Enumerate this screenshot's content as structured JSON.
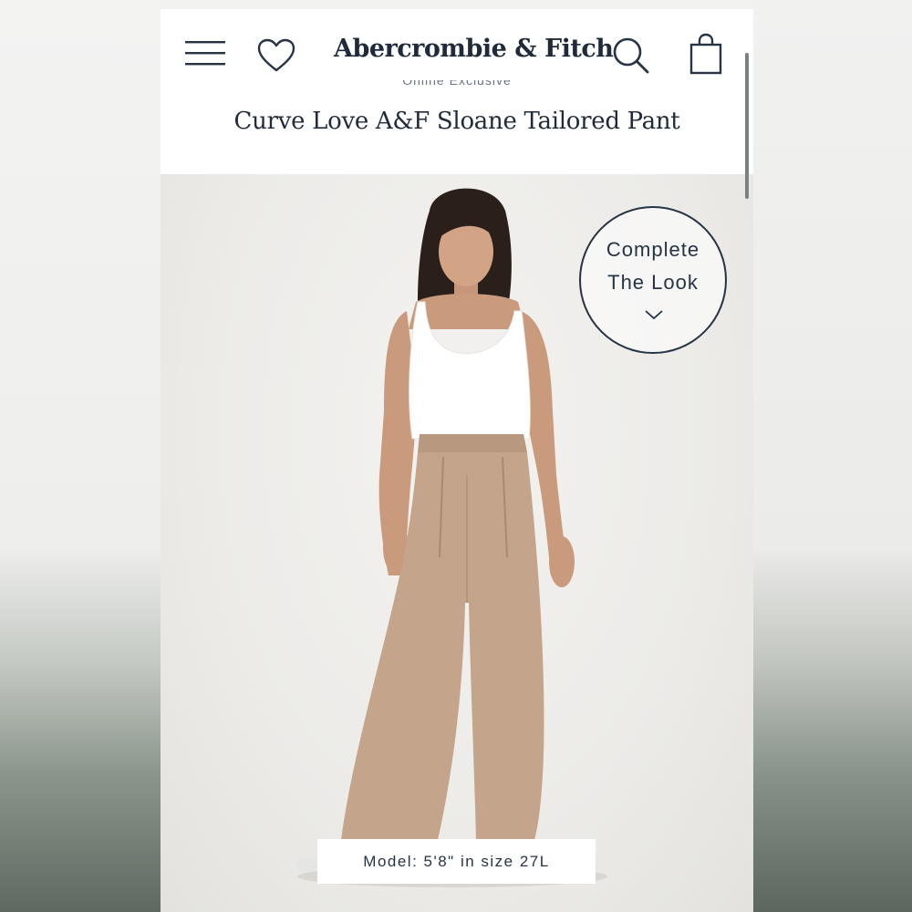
{
  "header": {
    "brand": "Abercrombie & Fitch",
    "menu_icon": "hamburger-menu-icon",
    "wishlist_icon": "heart-icon",
    "search_icon": "search-icon",
    "bag_icon": "shopping-bag-icon"
  },
  "product": {
    "eyebrow": "Online Exclusive",
    "title": "Curve Love A&F Sloane Tailored Pant"
  },
  "complete_the_look": {
    "line1": "Complete",
    "line2": "The Look",
    "icon": "chevron-down-icon"
  },
  "model_caption": "Model: 5'8\" in size 27L",
  "colors": {
    "navy": "#1f2b3a",
    "pant_tan": "#c4a48b",
    "top_white": "#ffffff"
  }
}
